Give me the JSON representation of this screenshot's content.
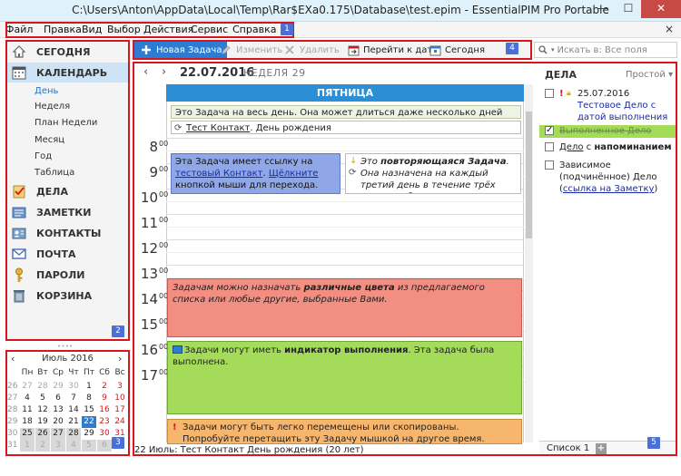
{
  "window": {
    "title": "C:\\Users\\Anton\\AppData\\Local\\Temp\\Rar$EXa0.175\\Database\\test.epim - EssentialPIM Pro Portable",
    "minimize": "—",
    "maximize": "☐",
    "close": "✕"
  },
  "menu": {
    "items": [
      "Файл",
      "Правка",
      "Вид",
      "Выбор",
      "Действия",
      "Сервис",
      "Справка"
    ],
    "close": "×"
  },
  "annotations": [
    "1",
    "2",
    "3",
    "4",
    "5"
  ],
  "nav": {
    "today": "СЕГОДНЯ",
    "calendar": "КАЛЕНДАРЬ",
    "calendar_views": [
      "День",
      "Неделя",
      "План Недели",
      "Месяц",
      "Год",
      "Таблица"
    ],
    "tasks": "ДЕЛА",
    "notes": "ЗАМЕТКИ",
    "contacts": "КОНТАКТЫ",
    "mail": "ПОЧТА",
    "passwords": "ПАРОЛИ",
    "trash": "КОРЗИНА",
    "divider": "• • • •"
  },
  "mini_calendar": {
    "title": "Июль  2016",
    "prev": "‹",
    "next": "›",
    "weekdays": [
      "Пн",
      "Вт",
      "Ср",
      "Чт",
      "Пт",
      "Сб",
      "Вс"
    ],
    "week_numbers": [
      "26",
      "27",
      "28",
      "29",
      "30",
      "31"
    ],
    "rows": [
      [
        "27",
        "28",
        "29",
        "30",
        "1",
        "2",
        "3"
      ],
      [
        "4",
        "5",
        "6",
        "7",
        "8",
        "9",
        "10"
      ],
      [
        "11",
        "12",
        "13",
        "14",
        "15",
        "16",
        "17"
      ],
      [
        "18",
        "19",
        "20",
        "21",
        "22",
        "23",
        "24"
      ],
      [
        "25",
        "26",
        "27",
        "28",
        "29",
        "30",
        "31"
      ],
      [
        "1",
        "2",
        "3",
        "4",
        "5",
        "6",
        "7"
      ]
    ],
    "selected_day": "22",
    "accent": "#2c7cd3"
  },
  "toolbar": {
    "new_task": "Новая Задача",
    "edit": "Изменить",
    "delete": "Удалить",
    "goto_date": "Перейти к дате",
    "today": "Сегодня",
    "search_placeholder": "Искать в: Все поля"
  },
  "day_view": {
    "prev": "‹",
    "next": "›",
    "date": "22.07.2016",
    "week": "НЕДЕЛЯ 29",
    "weekday": "ПЯТНИЦА",
    "hours": [
      "8",
      "9",
      "10",
      "11",
      "12",
      "13",
      "14",
      "15",
      "16",
      "17"
    ],
    "minutes": "00",
    "allday_task": "Это Задача на весь день. Она может длиться даже несколько дней подряд.",
    "allday_event_name": "Тест Контакт",
    "allday_event_rest": ". День рождения",
    "blue_event": {
      "t1": "Эта Задача имеет ссылку на ",
      "link1": "тестовый Контакт",
      "t2": ". ",
      "link2": "Щёлкните",
      "t3": " кнопкой мыши для перехода."
    },
    "recurring_event": {
      "t1": "Это ",
      "bold": "повторяющаяся Задача",
      "t2": ". Она назначена на каждый третий день в течение трёх недель и будет повторяться автоматически."
    },
    "red_event": {
      "t1": "Задачам можно назначать ",
      "bold": "различные цвета",
      "t2": "  из предлагаемого списка или любые другие, выбранные Вами."
    },
    "green_event": {
      "t1": "Задачи могут иметь ",
      "bold": "индикатор выполнения",
      "t2": ". Эта задача была выполнена."
    },
    "orange_event": "Задачи могут быть легко перемещены или скопированы. Попробуйте перетащить эту Задачу мышкой на другое время.",
    "status": "22 Июль:  Тест Контакт День рождения  (20 лет)",
    "colors": {
      "header": "#2c8fd6",
      "blue": "#8fa7e6",
      "red": "#f28f82",
      "green": "#a4dc5a",
      "orange": "#f7b66d"
    }
  },
  "tasks_panel": {
    "title": "ДЕЛА",
    "view": "Простой ▾",
    "item1_date": "25.07.2016",
    "item1_text": "Тестовое Дело с датой выполнения",
    "item2": "Выполненное Дело",
    "item3_link": "Дело",
    "item3_rest": " с ",
    "item3_bold": "напоминанием",
    "item4_text": "Зависимое (подчинённое) Дело (",
    "item4_link": "ссылка на Заметку",
    "item4_end": ")",
    "tab1": "Список 1",
    "tab_add": "+"
  }
}
